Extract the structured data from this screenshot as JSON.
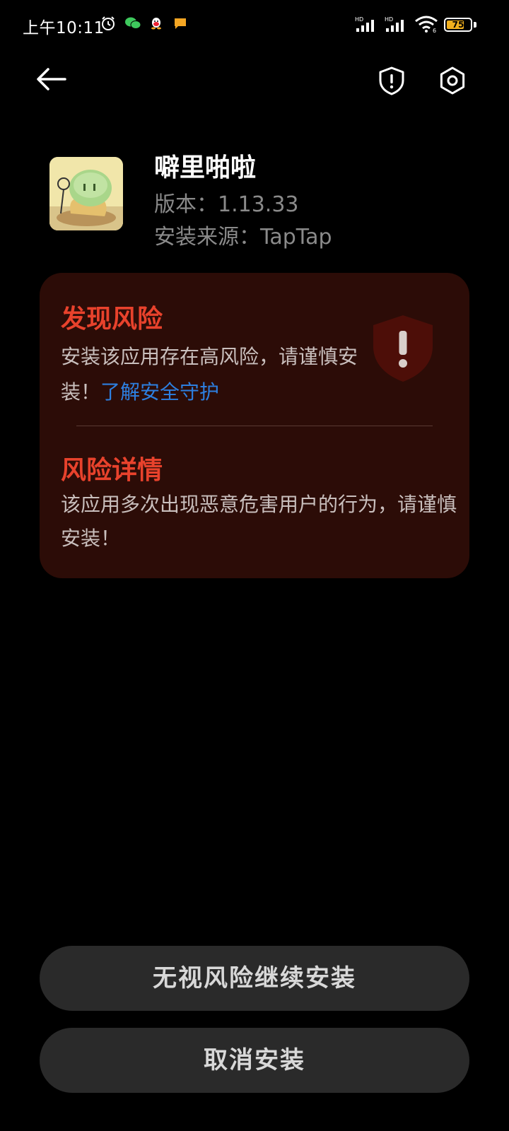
{
  "status_bar": {
    "time": "上午10:11",
    "battery_level": "75",
    "battery_fraction": 0.75,
    "network_labels": [
      "HD",
      "HD"
    ],
    "wifi_label": "6",
    "left_icons": [
      "alarm-icon",
      "wechat-icon",
      "qq-icon",
      "message-icon"
    ],
    "right_icons": [
      "signal-icon",
      "signal-icon",
      "wifi-icon",
      "battery-icon"
    ]
  },
  "header": {
    "back_icon": "arrow-left-icon",
    "shield_icon": "shield-exclamation-icon",
    "settings_icon": "gear-icon"
  },
  "app": {
    "name": "噼里啪啦",
    "version": "版本：1.13.33",
    "source": "安装来源：TapTap"
  },
  "risk": {
    "title": "发现风险",
    "description": "安装该应用存在高风险，请谨慎安装！",
    "link_text": "了解安全守护",
    "details_title": "风险详情",
    "details_description": "该应用多次出现恶意危害用户的行为，请谨慎安装！"
  },
  "actions": {
    "continue_label": "无视风险继续安装",
    "cancel_label": "取消安装"
  },
  "colors": {
    "background": "#000000",
    "card_background": "#2c0c07",
    "risk_red": "#e8422c",
    "link_blue": "#2d7fe0",
    "button_background": "#2a2a2a",
    "battery_yellow": "#f2b01e"
  }
}
